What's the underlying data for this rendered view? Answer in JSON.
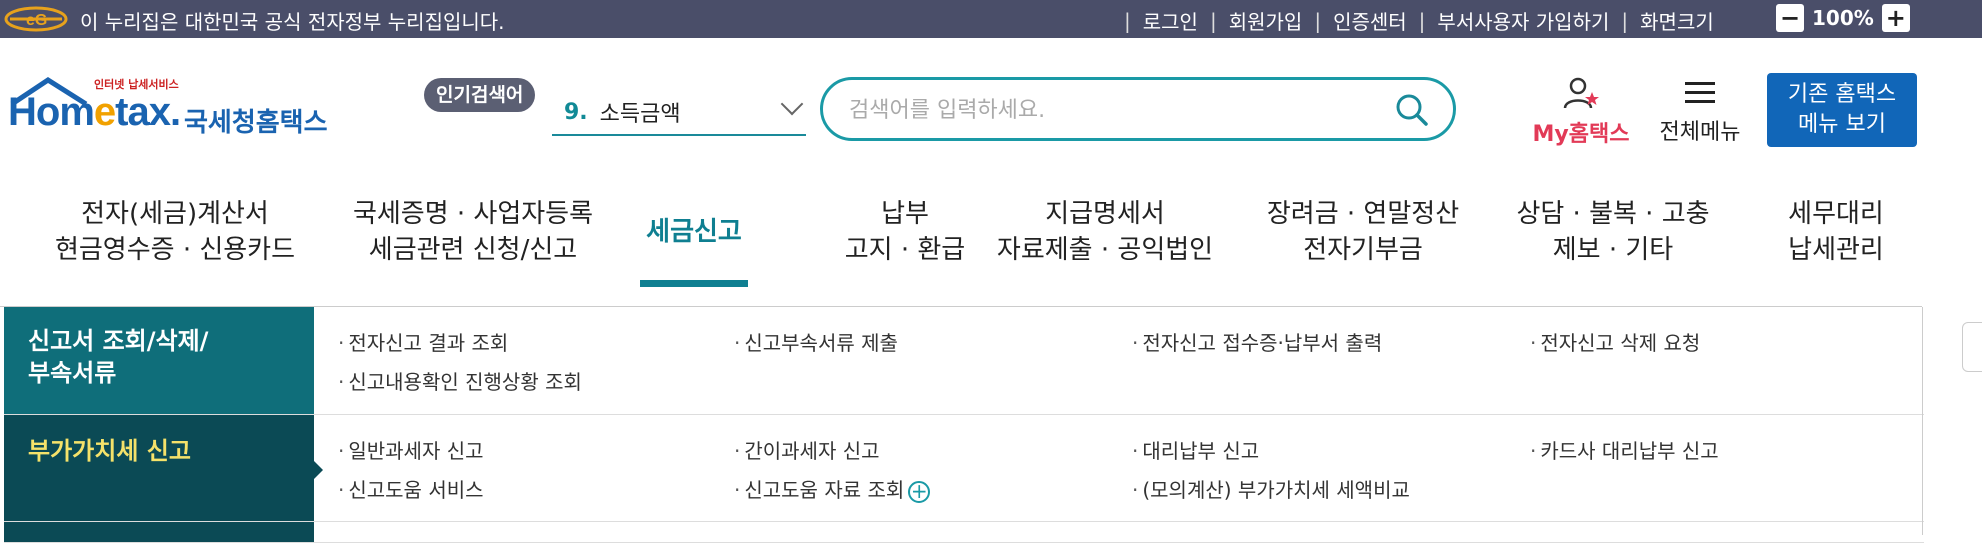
{
  "topbar": {
    "gov_notice": "이 누리집은 대한민국 공식 전자정부 누리집입니다.",
    "links": [
      "로그인",
      "회원가입",
      "인증센터",
      "부서사용자 가입하기",
      "화면크기"
    ],
    "zoom_value": "100%",
    "zoom_out": "−",
    "zoom_in": "+"
  },
  "logo": {
    "small": "인터넷 납세서비스",
    "home_pre": "Hom",
    "home_e": "e",
    "home_post": "tax.",
    "name": "국세청홈택스"
  },
  "popular": {
    "badge": "인기검색어",
    "rank": "9.",
    "term": "소득금액"
  },
  "search": {
    "placeholder": "검색어를 입력하세요."
  },
  "header_actions": {
    "my_hometax": "My홈택스",
    "all_menu": "전체메뉴",
    "legacy_line1": "기존 홈택스",
    "legacy_line2": "메뉴 보기"
  },
  "nav": [
    {
      "l1": "전자(세금)계산서",
      "l2": "현금영수증 · 신용카드"
    },
    {
      "l1": "국세증명 · 사업자등록",
      "l2": "세금관련 신청/신고"
    },
    {
      "l1": "세금신고",
      "l2": ""
    },
    {
      "l1": "납부",
      "l2": "고지 · 환급"
    },
    {
      "l1": "지급명세서",
      "l2": "자료제출 · 공익법인"
    },
    {
      "l1": "장려금 · 연말정산",
      "l2": "전자기부금"
    },
    {
      "l1": "상담 · 불복 · 고충",
      "l2": "제보 · 기타"
    },
    {
      "l1": "세무대리",
      "l2": "납세관리"
    }
  ],
  "submenu": {
    "row1": {
      "category_l1": "신고서 조회/삭제/",
      "category_l2": "부속서류",
      "links": [
        "전자신고 결과 조회",
        "신고부속서류 제출",
        "전자신고 접수증·납부서 출력",
        "전자신고 삭제 요청",
        "신고내용확인 진행상황 조회"
      ]
    },
    "row2": {
      "category": "부가가치세 신고",
      "links": [
        "일반과세자 신고",
        "간이과세자 신고",
        "대리납부 신고",
        "카드사 대리납부 신고",
        "신고도움 서비스",
        "신고도움 자료 조회",
        "(모의계산) 부가가치세 세액비교"
      ],
      "plus": "+"
    }
  },
  "colors": {
    "topbar": "#4a4e69",
    "accent_teal": "#0f7f91",
    "brand_blue": "#1a63b0",
    "my_red": "#e23a57",
    "legacy_btn": "#1166b8",
    "row2_label": "#f5e26a"
  }
}
